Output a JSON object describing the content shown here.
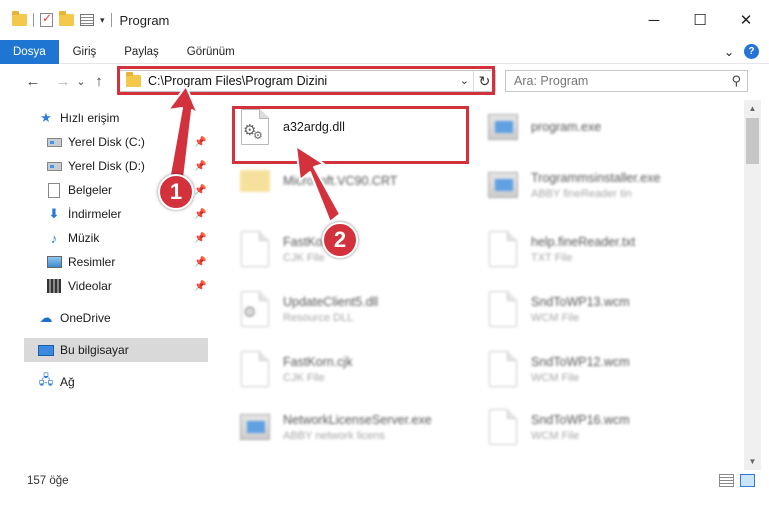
{
  "window": {
    "title": "Program",
    "controls": {
      "minimize": "─",
      "maximize": "☐",
      "close": "✕"
    }
  },
  "ribbon": {
    "tabs": [
      {
        "label": "Dosya",
        "active": true
      },
      {
        "label": "Giriş"
      },
      {
        "label": "Paylaş"
      },
      {
        "label": "Görünüm"
      }
    ],
    "expand": "⌄",
    "help": "?"
  },
  "nav": {
    "back": "←",
    "forward": "→",
    "recent": "⌄",
    "up": "↑"
  },
  "address": {
    "path": "C:\\Program Files\\Program Dizini",
    "dropdown": "⌄",
    "refresh": "↻"
  },
  "search": {
    "placeholder": "Ara: Program",
    "icon": "⚲"
  },
  "sidebar": {
    "quick_access": "Hızlı erişim",
    "items": [
      {
        "label": "Yerel Disk (C:)",
        "icon": "drive-icon",
        "pinned": true
      },
      {
        "label": "Yerel Disk (D:)",
        "icon": "drive-icon",
        "pinned": true
      },
      {
        "label": "Belgeler",
        "icon": "documents-icon",
        "pinned": true
      },
      {
        "label": "İndirmeler",
        "icon": "downloads-icon",
        "pinned": true
      },
      {
        "label": "Müzik",
        "icon": "music-icon",
        "pinned": true
      },
      {
        "label": "Resimler",
        "icon": "pictures-icon",
        "pinned": true
      },
      {
        "label": "Videolar",
        "icon": "videos-icon",
        "pinned": true
      }
    ],
    "onedrive": "OneDrive",
    "this_pc": "Bu bilgisayar",
    "network": "Ağ",
    "pin_glyph": "📌"
  },
  "files": [
    {
      "name": "a32ardg.dll",
      "type": "",
      "icon": "dll-file-icon"
    },
    {
      "name": "program.exe",
      "type": "",
      "icon": "exe-file-icon"
    },
    {
      "name": "Microsoft.VC90.CRT",
      "type": "",
      "icon": "folder-icon"
    },
    {
      "name": "Trogrammsinstaller.exe",
      "type": "ABBY fineReader tin",
      "icon": "exe-file-icon"
    },
    {
      "name": "FastKorn.cjk",
      "type": "CJK File",
      "icon": "file-icon"
    },
    {
      "name": "help.fineReader.txt",
      "type": "TXT File",
      "icon": "file-icon"
    },
    {
      "name": "UpdateClient5.dll",
      "type": "Resource DLL",
      "icon": "dll-file-icon"
    },
    {
      "name": "SndToWP13.wcm",
      "type": "WCM File",
      "icon": "file-icon"
    },
    {
      "name": "FastKorn.cjk",
      "type": "CJK File",
      "icon": "file-icon"
    },
    {
      "name": "SndToWP12.wcm",
      "type": "WCM File",
      "icon": "file-icon"
    },
    {
      "name": "NetworkLicenseServer.exe",
      "type": "ABBY network licens",
      "icon": "exe-file-icon"
    },
    {
      "name": "SndToWP16.wcm",
      "type": "WCM File",
      "icon": "file-icon"
    }
  ],
  "status": {
    "count": "157 öğe"
  },
  "callouts": {
    "one": "1",
    "two": "2"
  },
  "colors": {
    "accent": "#1e76d2",
    "highlight": "#d3313c",
    "selected": "#d9d9d9"
  }
}
